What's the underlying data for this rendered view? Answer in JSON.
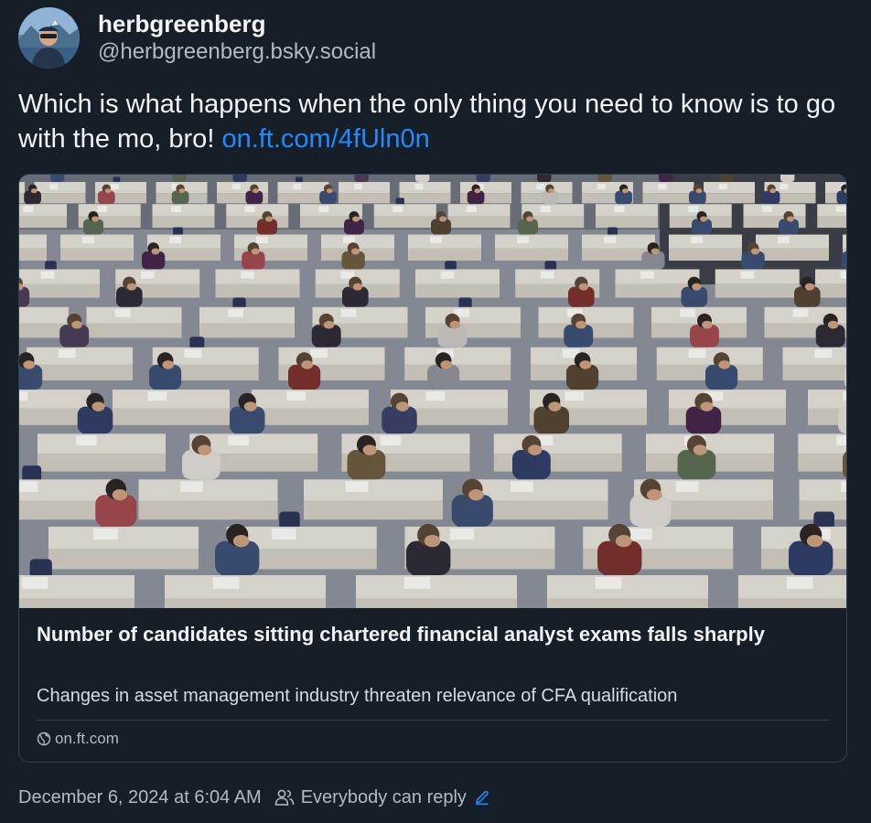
{
  "author": {
    "display_name": "herbgreenberg",
    "handle": "@herbgreenberg.bsky.social",
    "avatar_icon": "avatar-photo"
  },
  "post": {
    "text": "Which is what happens when the only thing you need to know is to go with the mo, bro! ",
    "link_text": "on.ft.com/4fUln0n"
  },
  "card": {
    "image_icon": "exam-hall-photo",
    "title": "Number of candidates sitting chartered financial analyst exams falls sharply",
    "description": "Changes in asset management industry threaten relevance of CFA qualification",
    "domain": "on.ft.com",
    "domain_icon": "globe-icon"
  },
  "meta": {
    "timestamp": "December 6, 2024 at 6:04 AM",
    "reply_setting": "Everybody can reply",
    "reply_icon": "people-icon",
    "edit_icon": "pencil-icon"
  },
  "colors": {
    "background": "#161e27",
    "text_primary": "#f1f3f5",
    "text_secondary": "#aebbc9",
    "link": "#208bfe",
    "border": "#2e4052"
  }
}
